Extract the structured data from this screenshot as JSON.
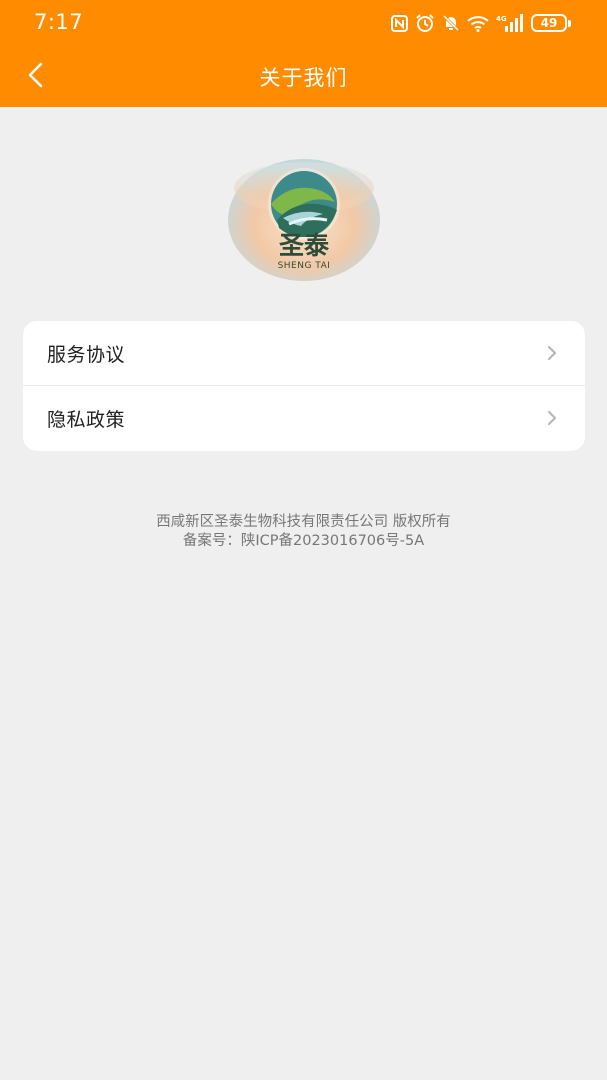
{
  "status_bar": {
    "time": "7:17",
    "network_label": "4G",
    "battery_level": "49",
    "icons": [
      "nfc-icon",
      "alarm-icon",
      "mute-icon",
      "wifi-icon",
      "signal-icon",
      "battery-icon"
    ]
  },
  "header": {
    "title": "关于我们",
    "back_icon": "back-arrow-icon",
    "background_color": "#ff8c00"
  },
  "logo": {
    "brand_chinese": "圣泰",
    "brand_pinyin": "SHENG TAI"
  },
  "menu": {
    "items": [
      {
        "label": "服务协议",
        "icon": "chevron-right-icon"
      },
      {
        "label": "隐私政策",
        "icon": "chevron-right-icon"
      }
    ]
  },
  "footer": {
    "copyright": "西咸新区圣泰生物科技有限责任公司 版权所有",
    "icp": "备案号：陕ICP备2023016706号-5A"
  },
  "colors": {
    "accent": "#ff8c00",
    "page_background": "#efefef",
    "card_background": "#ffffff",
    "footer_text": "#777777"
  }
}
